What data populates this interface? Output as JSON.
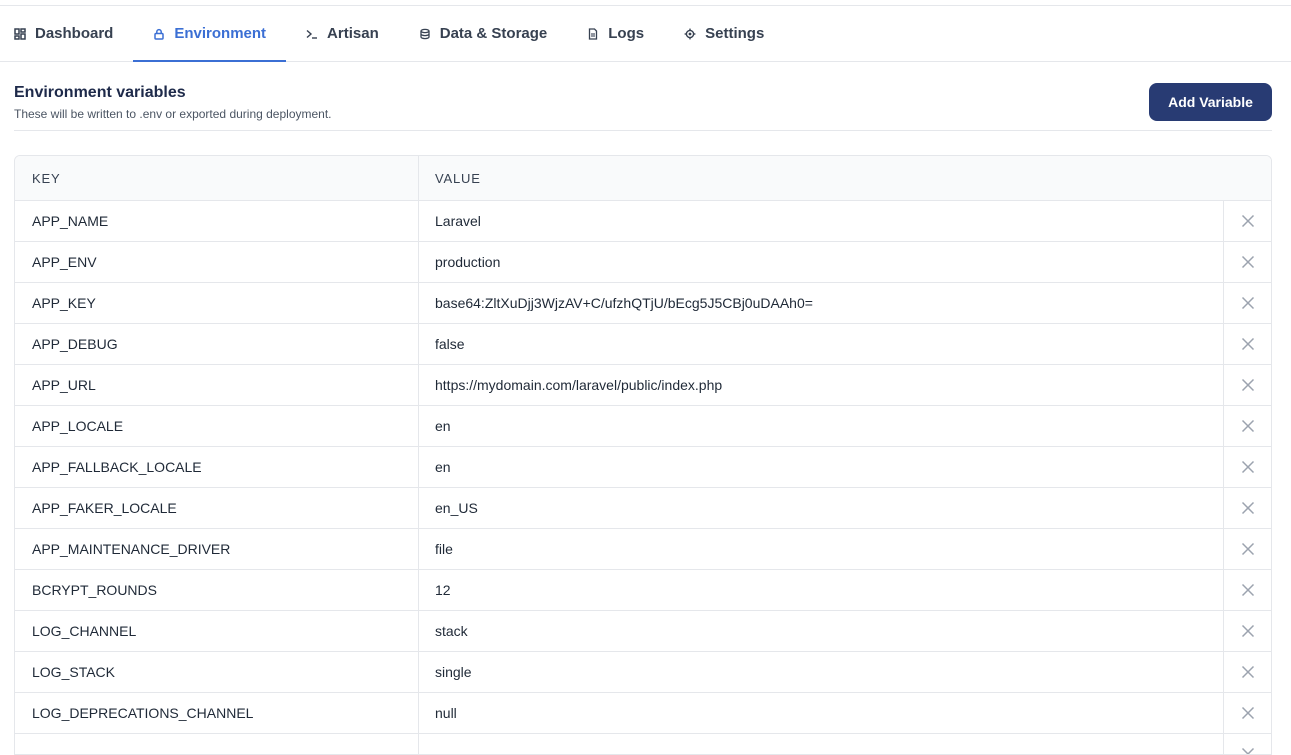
{
  "tabs": [
    {
      "label": "Dashboard",
      "icon": "dashboard-icon",
      "active": false
    },
    {
      "label": "Environment",
      "icon": "lock-icon",
      "active": true
    },
    {
      "label": "Artisan",
      "icon": "terminal-icon",
      "active": false
    },
    {
      "label": "Data & Storage",
      "icon": "database-icon",
      "active": false
    },
    {
      "label": "Logs",
      "icon": "document-icon",
      "active": false
    },
    {
      "label": "Settings",
      "icon": "gear-icon",
      "active": false
    }
  ],
  "header": {
    "title": "Environment variables",
    "subtitle": "These will be written to .env or exported during deployment.",
    "add_button": "Add Variable"
  },
  "table": {
    "headers": {
      "key": "KEY",
      "value": "VALUE"
    },
    "rows": [
      {
        "key": "APP_NAME",
        "value": "Laravel"
      },
      {
        "key": "APP_ENV",
        "value": "production"
      },
      {
        "key": "APP_KEY",
        "value": "base64:ZltXuDjj3WjzAV+C/ufzhQTjU/bEcg5J5CBj0uDAAh0="
      },
      {
        "key": "APP_DEBUG",
        "value": "false"
      },
      {
        "key": "APP_URL",
        "value": "https://mydomain.com/laravel/public/index.php"
      },
      {
        "key": "APP_LOCALE",
        "value": "en"
      },
      {
        "key": "APP_FALLBACK_LOCALE",
        "value": "en"
      },
      {
        "key": "APP_FAKER_LOCALE",
        "value": "en_US"
      },
      {
        "key": "APP_MAINTENANCE_DRIVER",
        "value": "file"
      },
      {
        "key": "BCRYPT_ROUNDS",
        "value": "12"
      },
      {
        "key": "LOG_CHANNEL",
        "value": "stack"
      },
      {
        "key": "LOG_STACK",
        "value": "single"
      },
      {
        "key": "LOG_DEPRECATIONS_CHANNEL",
        "value": "null"
      },
      {
        "key": "",
        "value": ""
      }
    ]
  },
  "colors": {
    "accent": "#3b6fd4",
    "button": "#283b73",
    "title": "#1e2a4a"
  }
}
